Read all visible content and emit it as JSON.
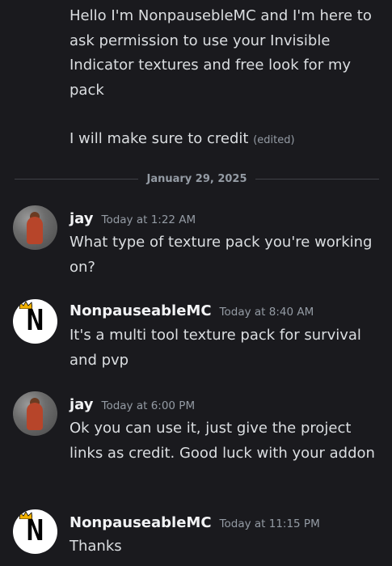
{
  "first_message": {
    "para1": "Hello I'm NonpausebleMC and I'm here to ask permission to use your Invisible Indicator textures and free look for my pack",
    "para2": "I will make sure to credit",
    "edited": "(edited)"
  },
  "divider": {
    "date": "January 29, 2025"
  },
  "messages": [
    {
      "author": "jay",
      "time": "Today at 1:22 AM",
      "text": "What type of texture pack you're working on?",
      "avatar": "jay-avatar"
    },
    {
      "author": "NonpauseableMC",
      "time": "Today at 8:40 AM",
      "text": "It's a multi tool texture pack for survival and pvp",
      "avatar": "nonpauseable-avatar"
    },
    {
      "author": "jay",
      "time": "Today at 6:00 PM",
      "text": "Ok you can use it, just give the project links as credit. Good luck with your addon",
      "avatar": "jay-avatar"
    },
    {
      "author": "NonpauseableMC",
      "time": "Today at 11:15 PM",
      "text": "Thanks",
      "avatar": "nonpauseable-avatar"
    }
  ],
  "avatar_letter": "N",
  "colors": {
    "background": "#1a1a1e",
    "username": "#f2f3f5",
    "text": "#dbdee1",
    "muted": "#949ba4"
  }
}
